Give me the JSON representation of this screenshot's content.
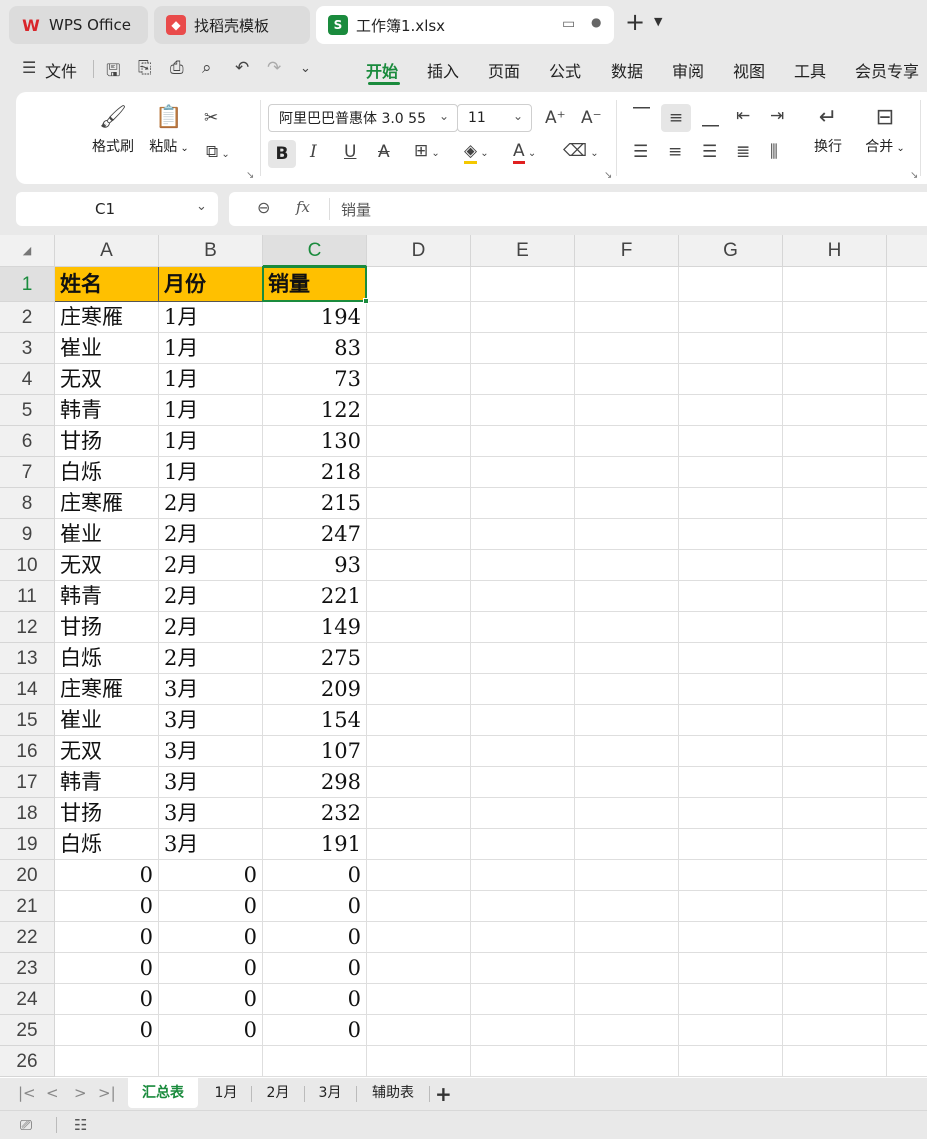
{
  "window_tabs": [
    {
      "label": "WPS Office",
      "icon": "wps-logo-icon"
    },
    {
      "label": "找稻壳模板",
      "icon": "docer-icon"
    },
    {
      "label": "工作簿1.xlsx",
      "icon": "spreadsheet-icon"
    }
  ],
  "menu": {
    "file_label": "文件",
    "tabs": [
      "开始",
      "插入",
      "页面",
      "公式",
      "数据",
      "审阅",
      "视图",
      "工具",
      "会员专享"
    ],
    "active_tab": "开始"
  },
  "ribbon": {
    "format_painter": "格式刷",
    "paste": "粘贴",
    "font_name": "阿里巴巴普惠体 3.0 55",
    "font_size": "11",
    "wrap": "换行",
    "merge": "合并"
  },
  "formula_bar": {
    "name_box": "C1",
    "fx_label": "fx",
    "content": "销量"
  },
  "columns": [
    "A",
    "B",
    "C",
    "D",
    "E",
    "F",
    "G",
    "H"
  ],
  "selected_column": "C",
  "selected_row": 1,
  "header_row": [
    "姓名",
    "月份",
    "销量"
  ],
  "rows": [
    [
      "庄寒雁",
      "1月",
      "194"
    ],
    [
      "崔业",
      "1月",
      "83"
    ],
    [
      "无双",
      "1月",
      "73"
    ],
    [
      "韩青",
      "1月",
      "122"
    ],
    [
      "甘扬",
      "1月",
      "130"
    ],
    [
      "白烁",
      "1月",
      "218"
    ],
    [
      "庄寒雁",
      "2月",
      "215"
    ],
    [
      "崔业",
      "2月",
      "247"
    ],
    [
      "无双",
      "2月",
      "93"
    ],
    [
      "韩青",
      "2月",
      "221"
    ],
    [
      "甘扬",
      "2月",
      "149"
    ],
    [
      "白烁",
      "2月",
      "275"
    ],
    [
      "庄寒雁",
      "3月",
      "209"
    ],
    [
      "崔业",
      "3月",
      "154"
    ],
    [
      "无双",
      "3月",
      "107"
    ],
    [
      "韩青",
      "3月",
      "298"
    ],
    [
      "甘扬",
      "3月",
      "232"
    ],
    [
      "白烁",
      "3月",
      "191"
    ],
    [
      "0",
      "0",
      "0"
    ],
    [
      "0",
      "0",
      "0"
    ],
    [
      "0",
      "0",
      "0"
    ],
    [
      "0",
      "0",
      "0"
    ],
    [
      "0",
      "0",
      "0"
    ],
    [
      "0",
      "0",
      "0"
    ],
    [
      "",
      "",
      ""
    ]
  ],
  "sheet_tabs": [
    "汇总表",
    "1月",
    "2月",
    "3月",
    "辅助表"
  ],
  "active_sheet": "汇总表",
  "colors": {
    "accent": "#1a8b3d",
    "header_fill": "#ffc000"
  }
}
